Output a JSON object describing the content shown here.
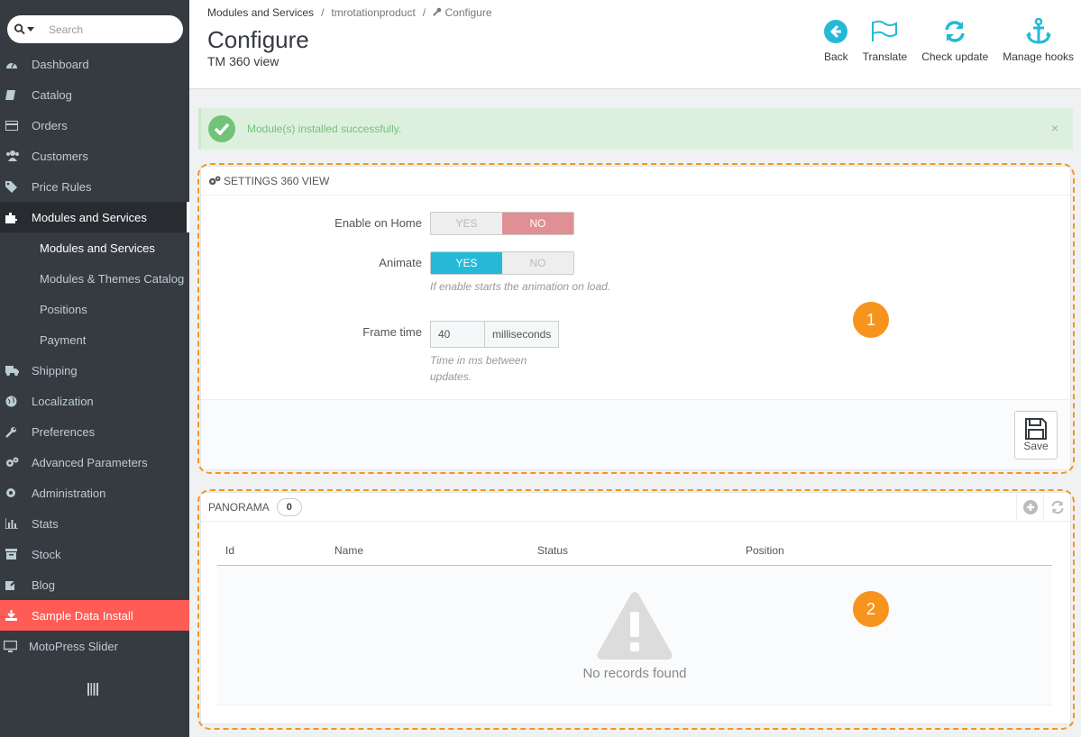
{
  "search": {
    "placeholder": "Search"
  },
  "sidebar": {
    "items": [
      {
        "label": "Dashboard",
        "icon": "tachometer-icon"
      },
      {
        "label": "Catalog",
        "icon": "book-icon"
      },
      {
        "label": "Orders",
        "icon": "credit-card-icon"
      },
      {
        "label": "Customers",
        "icon": "users-icon"
      },
      {
        "label": "Price Rules",
        "icon": "tags-icon"
      },
      {
        "label": "Modules and Services",
        "icon": "puzzle-icon"
      },
      {
        "label": "Shipping",
        "icon": "truck-icon"
      },
      {
        "label": "Localization",
        "icon": "globe-icon"
      },
      {
        "label": "Preferences",
        "icon": "wrench-icon"
      },
      {
        "label": "Advanced Parameters",
        "icon": "cogs-icon"
      },
      {
        "label": "Administration",
        "icon": "cog-icon"
      },
      {
        "label": "Stats",
        "icon": "bar-chart-icon"
      },
      {
        "label": "Stock",
        "icon": "archive-icon"
      },
      {
        "label": "Blog",
        "icon": "edit-icon"
      },
      {
        "label": "Sample Data Install",
        "icon": "download-icon"
      },
      {
        "label": "MotoPress Slider",
        "icon": "desktop-icon"
      }
    ],
    "subitems": [
      {
        "label": "Modules and Services"
      },
      {
        "label": "Modules & Themes Catalog"
      },
      {
        "label": "Positions"
      },
      {
        "label": "Payment"
      }
    ],
    "highlight_color": "#fe5c55"
  },
  "breadcrumb": {
    "item1": "Modules and Services",
    "item2": "tmrotationproduct",
    "item3": "Configure",
    "sep": "/"
  },
  "header": {
    "title": "Configure",
    "subtitle": "TM 360 view"
  },
  "toolbar": {
    "back": "Back",
    "translate": "Translate",
    "check_update": "Check update",
    "manage_hooks": "Manage hooks",
    "icon_color": "#25b9d7"
  },
  "alert": {
    "text": "Module(s) installed successfully.",
    "close": "×"
  },
  "settings": {
    "title": "SETTINGS 360 VIEW",
    "enable_home_label": "Enable on Home",
    "animate_label": "Animate",
    "yes": "YES",
    "no": "NO",
    "animate_help": "If enable starts the animation on load.",
    "frame_time_label": "Frame time",
    "frame_time_value": "40",
    "frame_time_unit": "milliseconds",
    "frame_time_help": "Time in ms between updates.",
    "save": "Save"
  },
  "panorama": {
    "title": "PANORAMA",
    "count": "0",
    "columns": [
      "Id",
      "Name",
      "Status",
      "Position"
    ],
    "empty": "No records found"
  },
  "markers": [
    "1",
    "2"
  ]
}
